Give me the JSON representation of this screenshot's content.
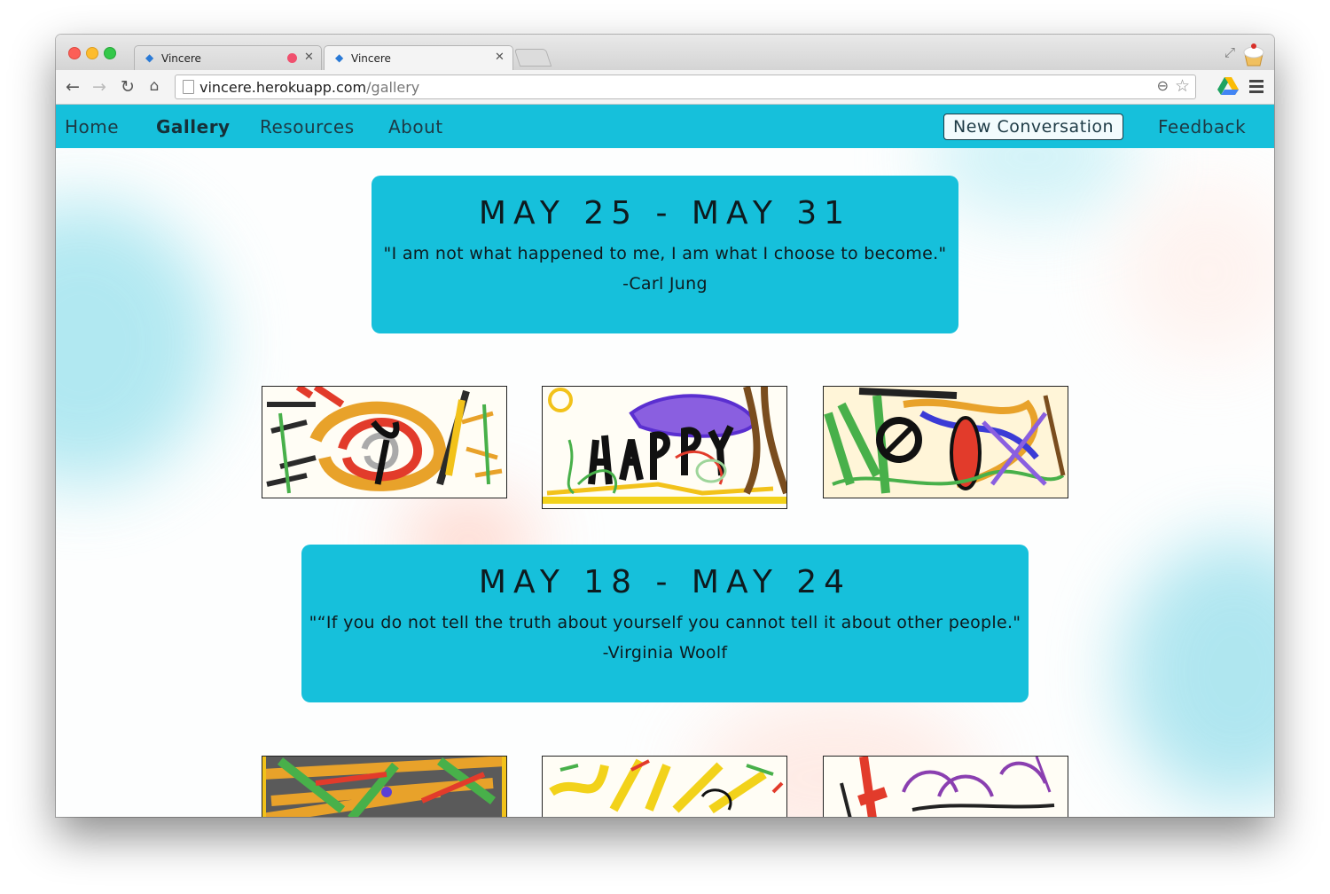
{
  "browser": {
    "tabs": [
      {
        "title": "Vincere",
        "recording": true
      },
      {
        "title": "Vincere",
        "recording": false
      }
    ],
    "url_host": "vincere.herokuapp.com",
    "url_path": "/gallery"
  },
  "nav": {
    "links": [
      "Home",
      "Gallery",
      "Resources",
      "About"
    ],
    "active": "Gallery",
    "new_conversation": "New Conversation",
    "feedback": "Feedback"
  },
  "weeks": [
    {
      "date": "MAY 25 - MAY 31",
      "quote": "\"I am not what happened to me, I am what I choose to become.\"",
      "author": "-Carl Jung"
    },
    {
      "date": "MAY 18 - MAY 24",
      "quote": "\"“If you do not tell the truth about yourself you cannot tell it about other people.\"",
      "author": "-Virginia Woolf"
    }
  ],
  "colors": {
    "brand": "#16c0db",
    "nav_text": "#1d3a45"
  }
}
